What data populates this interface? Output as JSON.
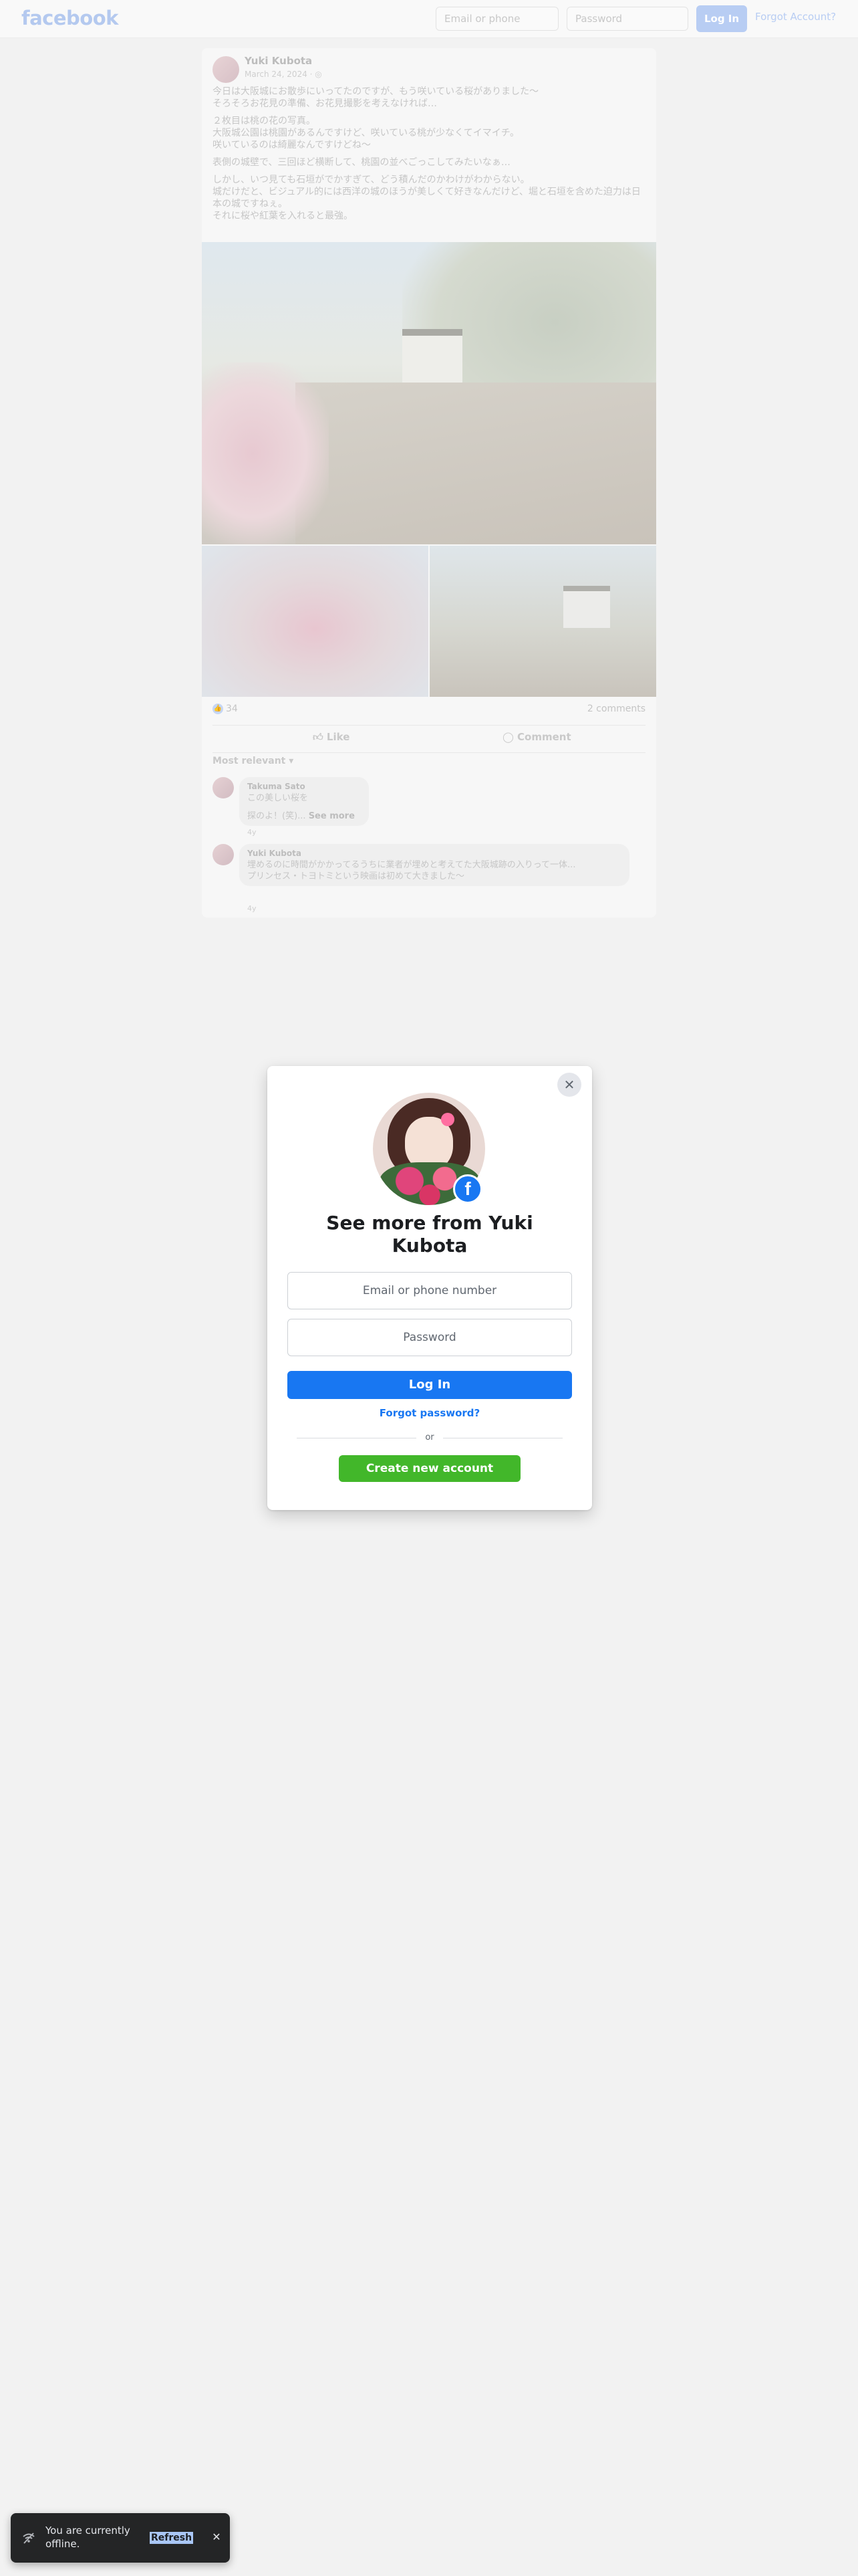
{
  "topbar": {
    "logo": "facebook",
    "email_placeholder": "Email or phone",
    "password_placeholder": "Password",
    "login_label": "Log In",
    "forgot_label": "Forgot Account?"
  },
  "post": {
    "author": "Yuki Kubota",
    "date": "March 24, 2024 · ",
    "audience_icon": "globe-icon",
    "paragraphs": [
      "今日は大阪城にお散歩にいってたのですが、もう咲いている桜がありました〜\nそろそろお花見の準備、お花見撮影を考えなければ…",
      "２枚目は桃の花の写真。\n大阪城公園は桃園があるんですけど、咲いている桃が少なくてイマイチ。\n咲いているのは綺麗なんですけどね〜",
      "表側の城壁で、三回ほど横断して、桃園の並べごっこしてみたいなぁ…",
      "しかし、いつ見ても石垣がでかすぎて、どう積んだのかわけがわからない。\n城だけだと、ビジュアル的には西洋の城のほうが美しくて好きなんだけど、堀と石垣を含めた迫力は日本の城ですねぇ。\nそれに桜や紅葉を入れると最強。"
    ],
    "reactions_count": "34",
    "comments_count": "2 comments",
    "like_label": "Like",
    "comment_label": "Comment",
    "sort_label": "Most relevant",
    "comments": [
      {
        "name": "Takuma Sato",
        "line1": "この美しい桜を",
        "line2": "探のよ！(笑)... ",
        "see_more": "See more",
        "time": "4y"
      },
      {
        "name": "Yuki Kubota",
        "line1": "埋めるのに時間がかかってるうちに業者が埋めと考えてた大阪城跡の入りって一体...",
        "line2": "プリンセス・トヨトミという映画は初めて大きました〜",
        "time": "4y"
      }
    ]
  },
  "modal": {
    "title": "See more from Yuki Kubota",
    "email_placeholder": "Email or phone number",
    "password_placeholder": "Password",
    "login_label": "Log In",
    "forgot_label": "Forgot password?",
    "or_label": "or",
    "create_label": "Create new account",
    "brand_color": "#1877f2",
    "create_color": "#42b72a"
  },
  "toast": {
    "text": "You are currently offline.",
    "refresh_label": "Refresh",
    "icon": "wifi-off-icon"
  }
}
